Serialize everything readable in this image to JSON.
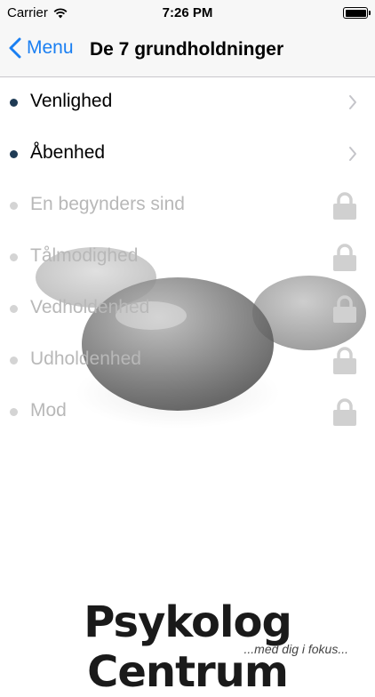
{
  "status_bar": {
    "carrier": "Carrier",
    "time": "7:26 PM"
  },
  "nav": {
    "back_label": "Menu",
    "title": "De 7 grundholdninger"
  },
  "items": [
    {
      "label": "Venlighed",
      "locked": false
    },
    {
      "label": "Åbenhed",
      "locked": false
    },
    {
      "label": "En begynders sind",
      "locked": true
    },
    {
      "label": "Tålmodighed",
      "locked": true
    },
    {
      "label": "Vedholdenhed",
      "locked": true
    },
    {
      "label": "Udholdenhed",
      "locked": true
    },
    {
      "label": "Mod",
      "locked": true
    }
  ],
  "footer": {
    "logo_text": "Psykolog Centrum",
    "tagline": "...med dig i fokus..."
  },
  "colors": {
    "accent": "#1a7ff2",
    "dot_active": "#1f3b55",
    "dot_locked": "#d4d4d4"
  }
}
